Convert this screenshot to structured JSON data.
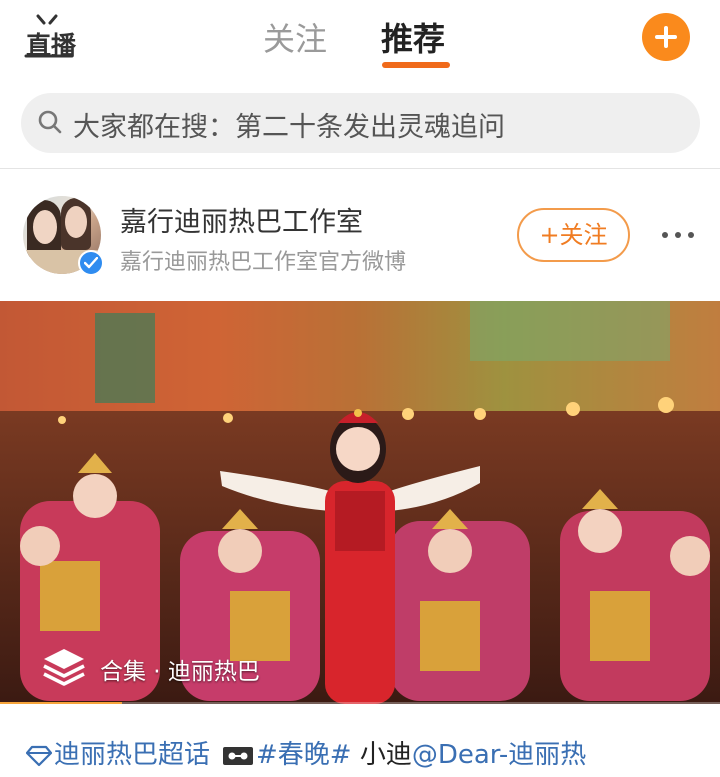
{
  "topbar": {
    "live_label": "直播",
    "tabs": [
      {
        "label": "关注",
        "active": false
      },
      {
        "label": "推荐",
        "active": true
      }
    ],
    "accent_color": "#f06a1a",
    "plus_icon": "plus-icon"
  },
  "search": {
    "icon": "search-icon",
    "text": "大家都在搜：第二十条发出灵魂追问"
  },
  "post": {
    "author": {
      "name": "嘉行迪丽热巴工作室",
      "description": "嘉行迪丽热巴工作室官方微博",
      "verified_badge": "verified-icon",
      "verified_color": "#2f8cf0"
    },
    "follow_label": "+关注",
    "more_icon": "more-dots-icon",
    "media": {
      "collection_label": "合集 · 迪丽热巴",
      "collection_icon": "stack-layers-icon",
      "progress": 0.17
    },
    "text": {
      "super_topic": "迪丽热巴超话",
      "hashtag": "#春晚#",
      "body": " 小迪",
      "mention": "@Dear-迪丽热"
    }
  }
}
